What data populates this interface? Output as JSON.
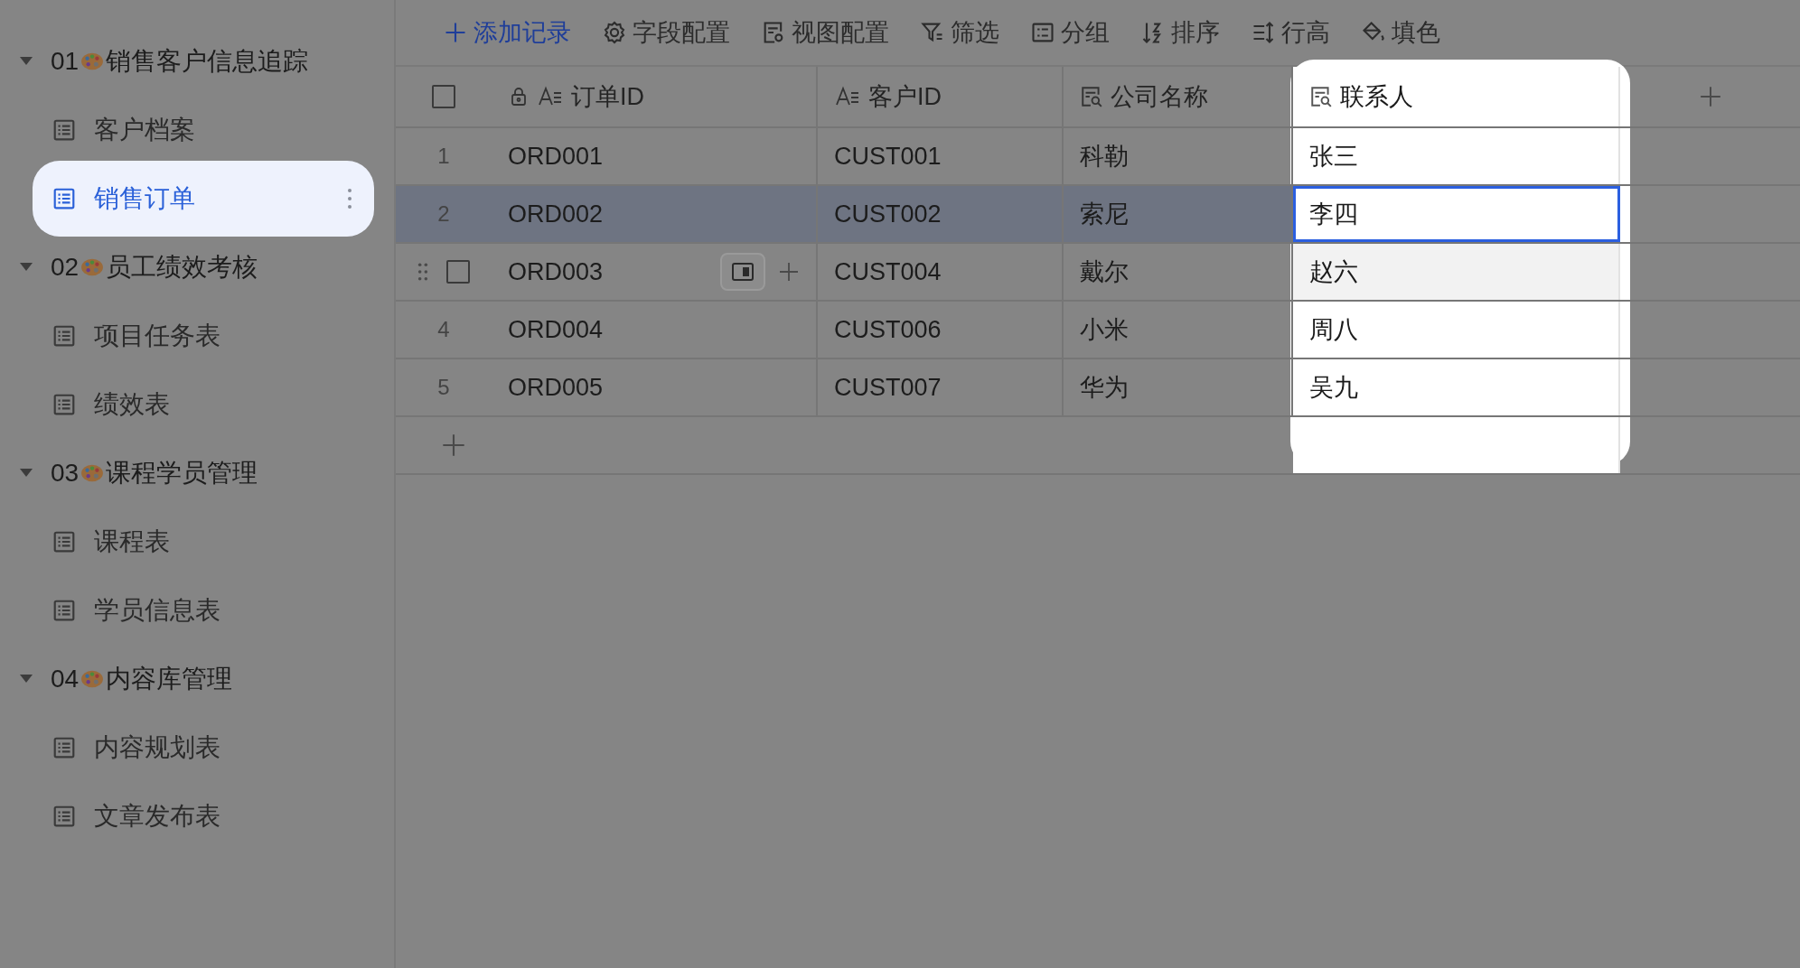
{
  "sidebar": {
    "groups": [
      {
        "number": "01",
        "name": "销售客户信息追踪",
        "expanded": true,
        "children": [
          {
            "label": "客户档案",
            "selected": false
          },
          {
            "label": "销售订单",
            "selected": true
          }
        ]
      },
      {
        "number": "02",
        "name": "员工绩效考核",
        "expanded": true,
        "children": [
          {
            "label": "项目任务表",
            "selected": false
          },
          {
            "label": "绩效表",
            "selected": false
          }
        ]
      },
      {
        "number": "03",
        "name": "课程学员管理",
        "expanded": true,
        "children": [
          {
            "label": "课程表",
            "selected": false
          },
          {
            "label": "学员信息表",
            "selected": false
          }
        ]
      },
      {
        "number": "04",
        "name": "内容库管理",
        "expanded": true,
        "children": [
          {
            "label": "内容规划表",
            "selected": false
          },
          {
            "label": "文章发布表",
            "selected": false
          }
        ]
      }
    ]
  },
  "toolbar": [
    {
      "label": "添加记录",
      "kind": "add"
    },
    {
      "label": "字段配置",
      "kind": "fields"
    },
    {
      "label": "视图配置",
      "kind": "view"
    },
    {
      "label": "筛选",
      "kind": "filter"
    },
    {
      "label": "分组",
      "kind": "group"
    },
    {
      "label": "排序",
      "kind": "sort"
    },
    {
      "label": "行高",
      "kind": "height"
    },
    {
      "label": "填色",
      "kind": "fill"
    }
  ],
  "table": {
    "all_checked": false,
    "columns": [
      {
        "label": "订单ID",
        "kind": "text",
        "locked": true,
        "highlighted": false
      },
      {
        "label": "客户ID",
        "kind": "text",
        "locked": false,
        "highlighted": false
      },
      {
        "label": "公司名称",
        "kind": "lookup",
        "locked": false,
        "highlighted": false
      },
      {
        "label": "联系人",
        "kind": "lookup",
        "locked": false,
        "highlighted": true
      }
    ],
    "rows": [
      {
        "number": "1",
        "selected": false,
        "hovered": false,
        "cells": [
          {
            "text": "ORD001",
            "active": false
          },
          {
            "text": "CUST001",
            "active": false
          },
          {
            "text": "科勒",
            "active": false
          },
          {
            "text": "张三",
            "active": false
          }
        ]
      },
      {
        "number": "2",
        "selected": true,
        "hovered": false,
        "cells": [
          {
            "text": "ORD002",
            "active": false
          },
          {
            "text": "CUST002",
            "active": false
          },
          {
            "text": "索尼",
            "active": false
          },
          {
            "text": "李四",
            "active": true
          }
        ]
      },
      {
        "selected": false,
        "hovered": true,
        "checked": false,
        "cells": [
          {
            "text": "ORD003",
            "active": false
          },
          {
            "text": "CUST004",
            "active": false
          },
          {
            "text": "戴尔",
            "active": false
          },
          {
            "text": "赵六",
            "active": false
          }
        ]
      },
      {
        "number": "4",
        "selected": false,
        "hovered": false,
        "cells": [
          {
            "text": "ORD004",
            "active": false
          },
          {
            "text": "CUST006",
            "active": false
          },
          {
            "text": "小米",
            "active": false
          },
          {
            "text": "周八",
            "active": false
          }
        ]
      },
      {
        "number": "5",
        "selected": false,
        "hovered": false,
        "cells": [
          {
            "text": "ORD005",
            "active": false
          },
          {
            "text": "CUST007",
            "active": false
          },
          {
            "text": "华为",
            "active": false
          },
          {
            "text": "吴九",
            "active": false
          }
        ]
      }
    ]
  }
}
